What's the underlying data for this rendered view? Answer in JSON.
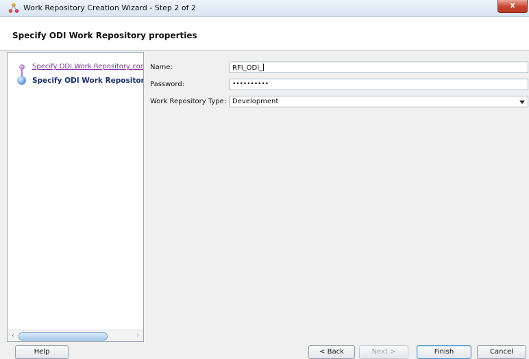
{
  "window": {
    "title": "Work Repository Creation Wizard - Step 2 of 2",
    "close_label": "x"
  },
  "header": {
    "title": "Specify ODI Work Repository properties"
  },
  "steps": [
    {
      "label": "Specify ODI Work Repository conn",
      "state": "completed"
    },
    {
      "label": "Specify ODI Work Repository",
      "state": "current"
    }
  ],
  "form": {
    "name_label": "Name:",
    "name_value": "RFI_ODI_",
    "password_label": "Password:",
    "password_value": "••••••••••",
    "type_label": "Work Repository Type:",
    "type_value": "Development"
  },
  "buttons": {
    "help": "Help",
    "back": "< Back",
    "next": "Next >",
    "finish": "Finish",
    "cancel": "Cancel"
  },
  "icons": {
    "app": "odi-wizard-icon",
    "dropdown": "chevron-down-icon"
  },
  "colors": {
    "accent": "#2f66b0",
    "completed_step": "#7a2f9c",
    "close": "#c7452f"
  }
}
